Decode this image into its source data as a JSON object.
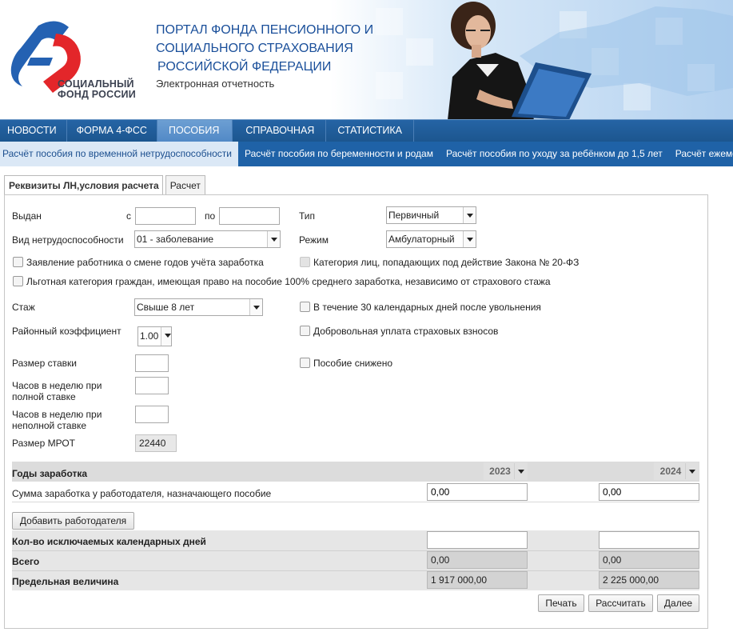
{
  "header": {
    "logo_line1": "СОЦИАЛЬНЫЙ",
    "logo_line2": "ФОНД РОССИИ",
    "title_line1": "ПОРТАЛ ФОНДА ПЕНСИОННОГО И",
    "title_line2": "СОЦИАЛЬНОГО СТРАХОВАНИЯ",
    "title_line3": "РОССИЙСКОЙ ФЕДЕРАЦИИ",
    "subtitle": "Электронная отчетность"
  },
  "menu": {
    "items": [
      "НОВОСТИ",
      "ФОРМА 4-ФСС",
      "ПОСОБИЯ",
      "СПРАВОЧНАЯ",
      "СТАТИСТИКА"
    ],
    "active": "ПОСОБИЯ"
  },
  "submenu": {
    "items": [
      "Расчёт пособия по временной нетрудоспособности",
      "Расчёт пособия по беременности и родам",
      "Расчёт пособия по уходу за ребёнком до 1,5 лет",
      "Расчёт ежемесячного"
    ]
  },
  "tabs": {
    "requisites": "Реквизиты ЛН,условия расчета",
    "calc": "Расчет"
  },
  "form": {
    "issued_label": "Выдан",
    "from_label": "с",
    "to_label": "по",
    "from_value": "",
    "to_value": "",
    "type_label": "Тип",
    "type_value": "Первичный",
    "disability_label": "Вид нетрудоспособности",
    "disability_value": "01 - заболевание",
    "mode_label": "Режим",
    "mode_value": "Амбулаторный",
    "cb_change_years": "Заявление работника о смене годов учёта заработка",
    "cb_law_20fz": "Категория лиц, попадающих под действие Закона № 20-ФЗ",
    "cb_privileged": "Льготная категория граждан, имеющая право на пособие 100% среднего заработка, независимо от страхового стажа",
    "experience_label": "Стаж",
    "experience_value": "Свыше 8 лет",
    "cb_30days": "В течение 30 календарных дней после увольнения",
    "regional_label": "Районный коэффициент",
    "regional_value": "1.00",
    "cb_voluntary": "Добровольная уплата страховых взносов",
    "rate_label": "Размер ставки",
    "rate_value": "",
    "cb_reduced": "Пособие снижено",
    "hours_full_label1": "Часов в неделю при",
    "hours_full_label2": "полной ставке",
    "hours_full_value": "",
    "hours_part_label1": "Часов в неделю при",
    "hours_part_label2": "неполной ставке",
    "hours_part_value": "",
    "mrot_label": "Размер МРОТ",
    "mrot_value": "22440"
  },
  "earnings": {
    "years_label": "Годы заработка",
    "year1": "2023",
    "year2": "2024",
    "sum_label": "Сумма заработка у работодателя, назначающего пособие",
    "sum1": "0,00",
    "sum2": "0,00",
    "add_employer": "Добавить работодателя",
    "excluded_label": "Кол-во исключаемых календарных дней",
    "excluded1": "",
    "excluded2": "",
    "total_label": "Всего",
    "total1": "0,00",
    "total2": "0,00",
    "limit_label": "Предельная величина",
    "limit1": "1 917 000,00",
    "limit2": "2 225 000,00"
  },
  "buttons": {
    "print": "Печать",
    "calculate": "Рассчитать",
    "next": "Далее"
  },
  "colors": {
    "menu_bg": "#1f62a7",
    "menu_active": "#5c93cc",
    "title": "#1a4f9a"
  }
}
